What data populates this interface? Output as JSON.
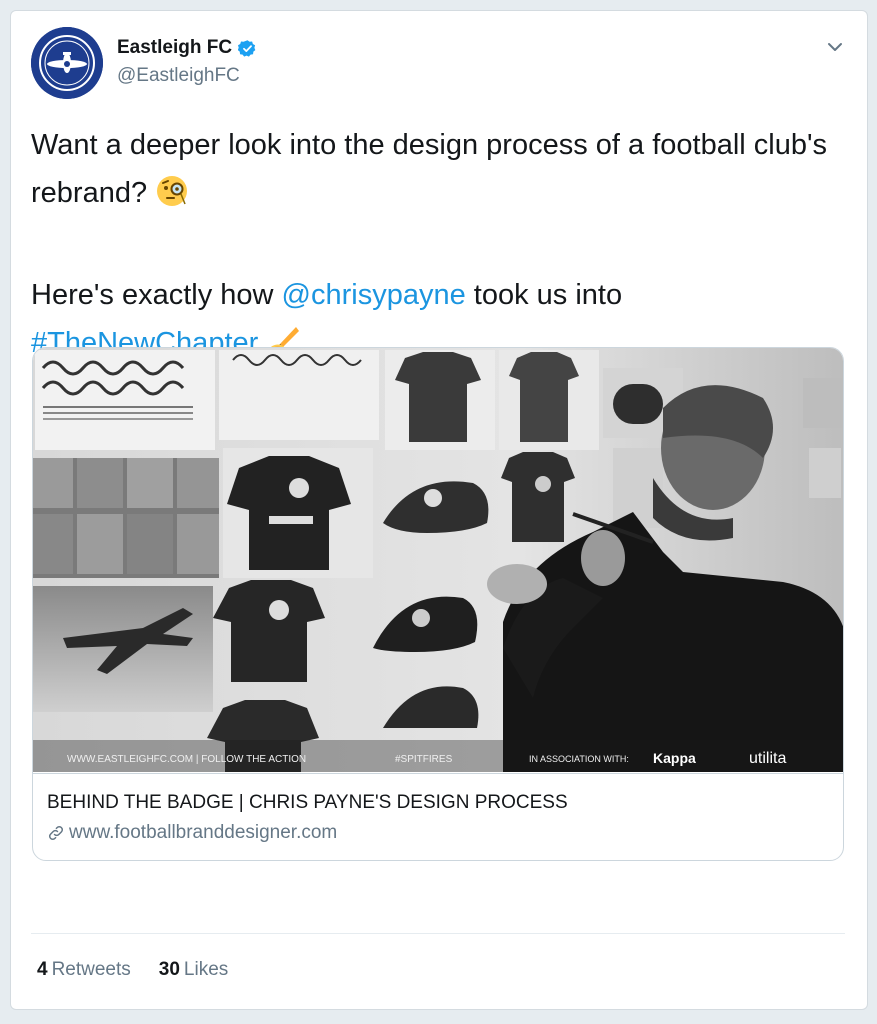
{
  "author": {
    "display_name": "Eastleigh FC",
    "handle": "@EastleighFC",
    "avatar_icon": "club-crest-icon",
    "verified_icon": "verified-badge-icon"
  },
  "tweet": {
    "line1": "Want a deeper look into the design process of a football club's rebrand? ",
    "line2_prefix": "Here's exactly how ",
    "mention": "@chrisypayne",
    "line2_middle": " took us into",
    "hashtag": "#TheNewChapter",
    "emoji_1": "monocle-face",
    "emoji_2": "writing-hand"
  },
  "link_card": {
    "title": "BEHIND THE BADGE | CHRIS PAYNE'S DESIGN PROCESS",
    "domain": "www.footballbranddesigner.com",
    "media_footer_left": "WWW.EASTLEIGHFC.COM | FOLLOW THE ACTION",
    "media_footer_tag": "#SPITFIRES",
    "media_footer_right_prefix": "IN ASSOCIATION WITH:",
    "sponsor_1": "Kappa",
    "sponsor_2": "utilita"
  },
  "stats": {
    "retweets_count": "4",
    "retweets_label": "Retweets",
    "likes_count": "30",
    "likes_label": "Likes"
  },
  "colors": {
    "accent": "#1b95e0",
    "secondary_text": "#657786",
    "primary_text": "#14171a",
    "avatar_bg": "#1e3d8f"
  }
}
